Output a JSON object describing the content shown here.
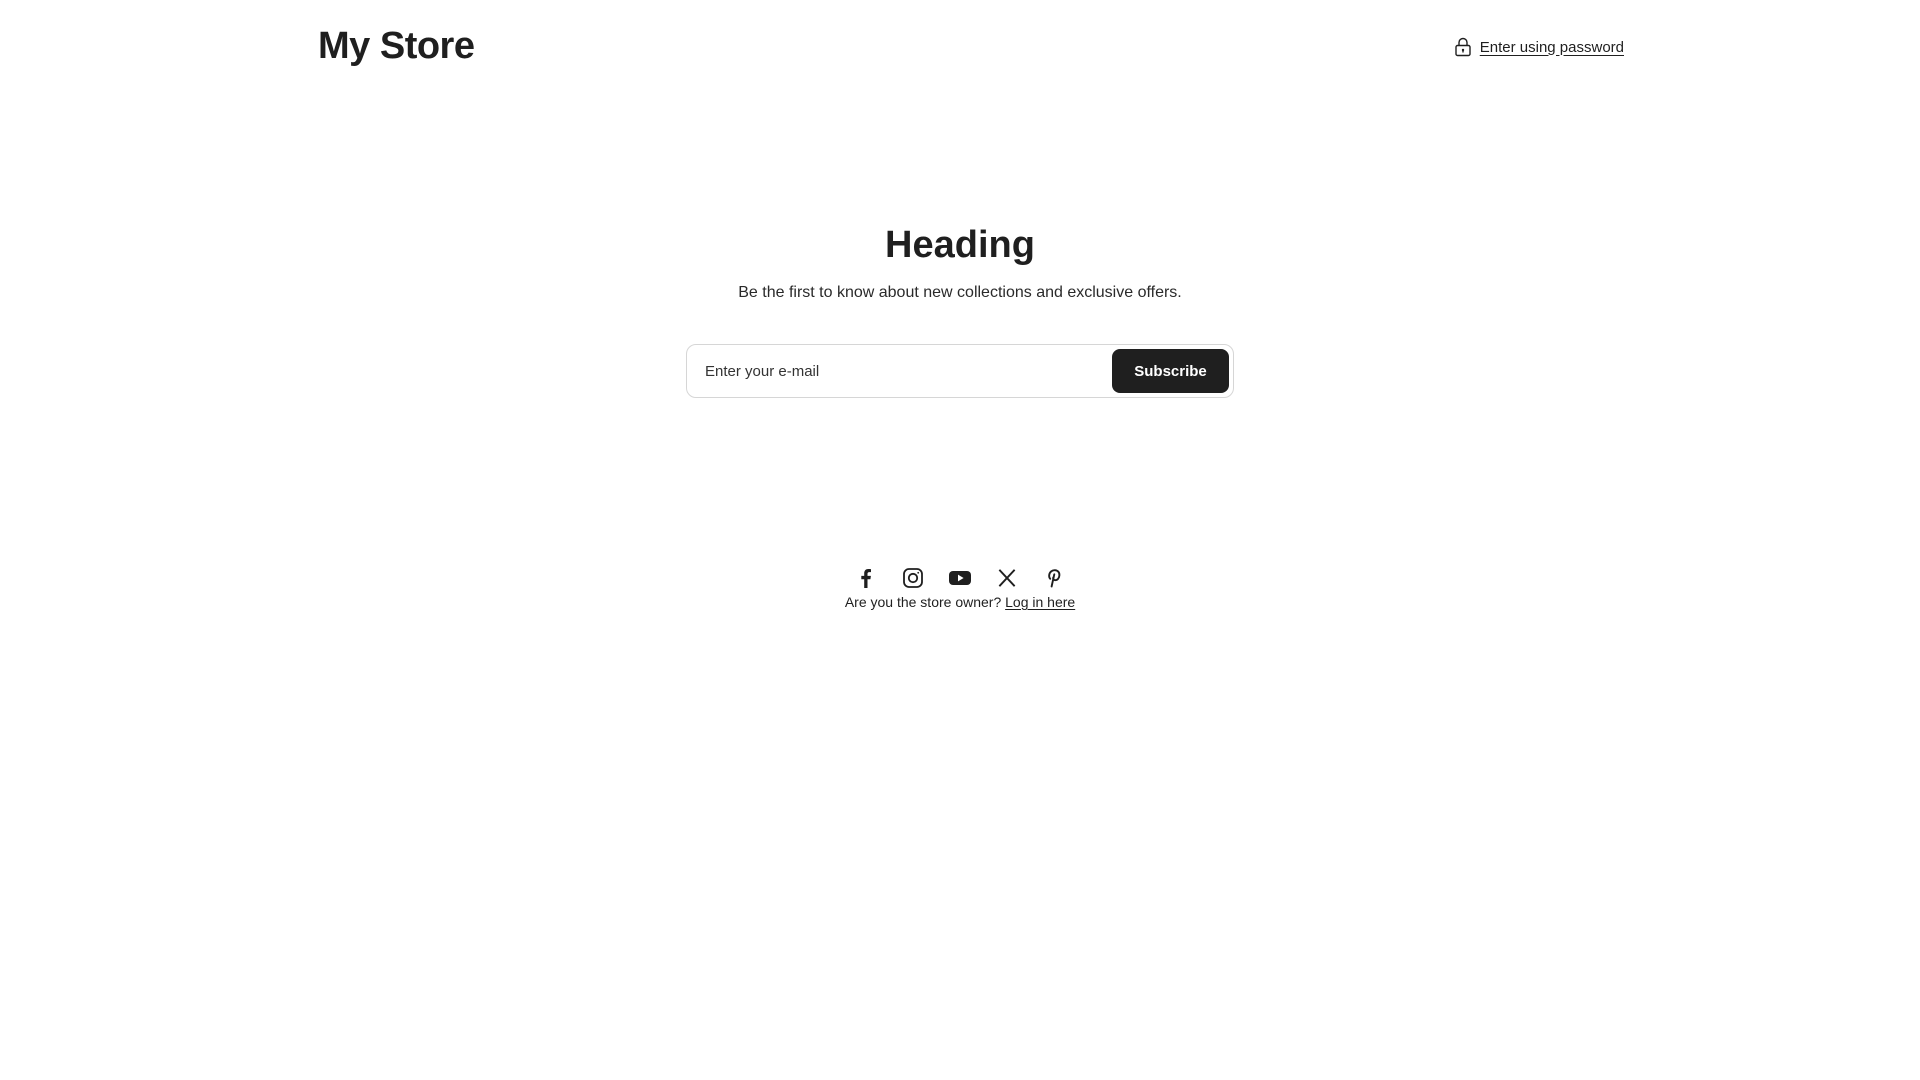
{
  "header": {
    "store_name": "My Store",
    "password_link_label": "Enter using password",
    "password_icon": "lock-icon"
  },
  "main": {
    "heading": "Heading",
    "subtext": "Be the first to know about new collections and exclusive offers.",
    "email_placeholder": "Enter your e-mail",
    "email_value": "",
    "subscribe_label": "Subscribe"
  },
  "footer": {
    "social_icons": [
      "facebook-icon",
      "instagram-icon",
      "youtube-icon",
      "x-icon",
      "pinterest-icon"
    ],
    "owner_prompt": "Are you the store owner?",
    "login_label": "Log in here"
  },
  "colors": {
    "text": "#1f1f1f",
    "button_bg": "#1f1f1f",
    "button_text": "#ffffff",
    "border": "#d6d6d6",
    "background": "#ffffff"
  }
}
